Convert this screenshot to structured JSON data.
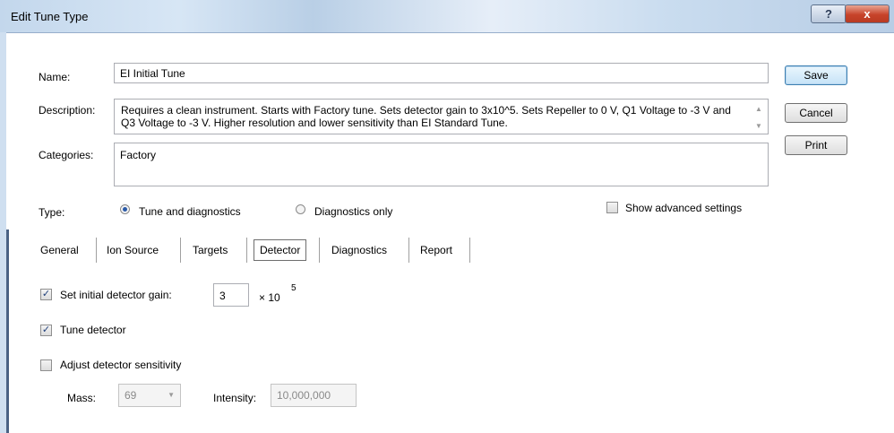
{
  "window": {
    "title": "Edit Tune Type",
    "help_glyph": "?",
    "close_glyph": "x"
  },
  "form": {
    "name_label": "Name:",
    "name_value": "EI Initial Tune",
    "description_label": "Description:",
    "description_value": "Requires a clean instrument. Starts with Factory tune. Sets detector gain to 3x10^5. Sets Repeller to 0 V, Q1 Voltage to -3 V and Q3 Voltage to -3 V. Higher resolution and lower sensitivity than EI Standard Tune.",
    "categories_label": "Categories:",
    "categories_value": "Factory",
    "type_label": "Type:",
    "type_options": [
      {
        "label": "Tune and diagnostics",
        "selected": true
      },
      {
        "label": "Diagnostics only",
        "selected": false
      }
    ],
    "show_advanced_label": "Show advanced settings",
    "show_advanced_checked": false
  },
  "buttons": {
    "save": "Save",
    "cancel": "Cancel",
    "print": "Print"
  },
  "tabs": [
    {
      "label": "General",
      "active": false
    },
    {
      "label": "Ion Source",
      "active": false
    },
    {
      "label": "Targets",
      "active": false
    },
    {
      "label": "Detector",
      "active": true
    },
    {
      "label": "Diagnostics",
      "active": false
    },
    {
      "label": "Report",
      "active": false
    }
  ],
  "detector": {
    "set_gain_label": "Set initial detector gain:",
    "set_gain_checked": true,
    "gain_value": "3",
    "gain_multiplier": "× 10",
    "gain_exponent": "5",
    "tune_detector_label": "Tune detector",
    "tune_detector_checked": true,
    "adjust_sensitivity_label": "Adjust detector sensitivity",
    "adjust_sensitivity_checked": false,
    "mass_label": "Mass:",
    "mass_value": "69",
    "intensity_label": "Intensity:",
    "intensity_value": "10,000,000"
  },
  "colors": {
    "title_gradient": "#c3d7ec",
    "close_button": "#c7432a",
    "default_button_border": "#3c7fb1",
    "check_mark": "#1f3f7a"
  }
}
